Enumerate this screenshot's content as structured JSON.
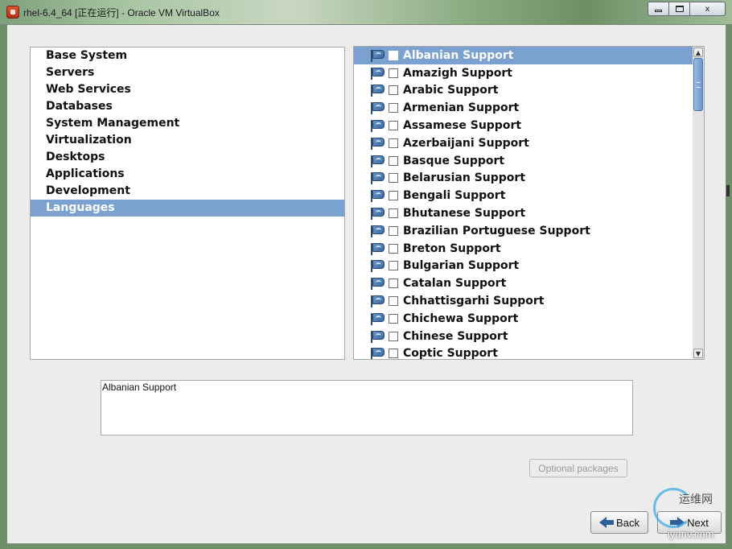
{
  "window": {
    "title": "rhel-6.4_64 [正在运行] - Oracle VM VirtualBox",
    "minimize_icon": "minimize-icon",
    "maximize_icon": "maximize-icon",
    "close_label": "x"
  },
  "categories": {
    "items": [
      {
        "label": "Base System",
        "selected": false
      },
      {
        "label": "Servers",
        "selected": false
      },
      {
        "label": "Web Services",
        "selected": false
      },
      {
        "label": "Databases",
        "selected": false
      },
      {
        "label": "System Management",
        "selected": false
      },
      {
        "label": "Virtualization",
        "selected": false
      },
      {
        "label": "Desktops",
        "selected": false
      },
      {
        "label": "Applications",
        "selected": false
      },
      {
        "label": "Development",
        "selected": false
      },
      {
        "label": "Languages",
        "selected": true
      }
    ]
  },
  "packages": {
    "icon": "language-flag-icon",
    "items": [
      {
        "label": "Albanian Support",
        "checked": false,
        "selected": true
      },
      {
        "label": "Amazigh Support",
        "checked": false,
        "selected": false
      },
      {
        "label": "Arabic Support",
        "checked": false,
        "selected": false
      },
      {
        "label": "Armenian Support",
        "checked": false,
        "selected": false
      },
      {
        "label": "Assamese Support",
        "checked": false,
        "selected": false
      },
      {
        "label": "Azerbaijani Support",
        "checked": false,
        "selected": false
      },
      {
        "label": "Basque Support",
        "checked": false,
        "selected": false
      },
      {
        "label": "Belarusian Support",
        "checked": false,
        "selected": false
      },
      {
        "label": "Bengali Support",
        "checked": false,
        "selected": false
      },
      {
        "label": "Bhutanese Support",
        "checked": false,
        "selected": false
      },
      {
        "label": "Brazilian Portuguese Support",
        "checked": false,
        "selected": false
      },
      {
        "label": "Breton Support",
        "checked": false,
        "selected": false
      },
      {
        "label": "Bulgarian Support",
        "checked": false,
        "selected": false
      },
      {
        "label": "Catalan Support",
        "checked": false,
        "selected": false
      },
      {
        "label": "Chhattisgarhi Support",
        "checked": false,
        "selected": false
      },
      {
        "label": "Chichewa Support",
        "checked": false,
        "selected": false
      },
      {
        "label": "Chinese Support",
        "checked": false,
        "selected": false
      },
      {
        "label": "Coptic Support",
        "checked": false,
        "selected": false
      }
    ]
  },
  "description": {
    "text": "Albanian Support"
  },
  "buttons": {
    "optional_packages": "Optional packages",
    "optional_packages_enabled": false,
    "back": "Back",
    "next": "Next"
  },
  "watermark": {
    "cn": "运维网",
    "url": "iyunv.com"
  },
  "colors": {
    "selection": "#7aa1d0",
    "background": "#ececec"
  }
}
